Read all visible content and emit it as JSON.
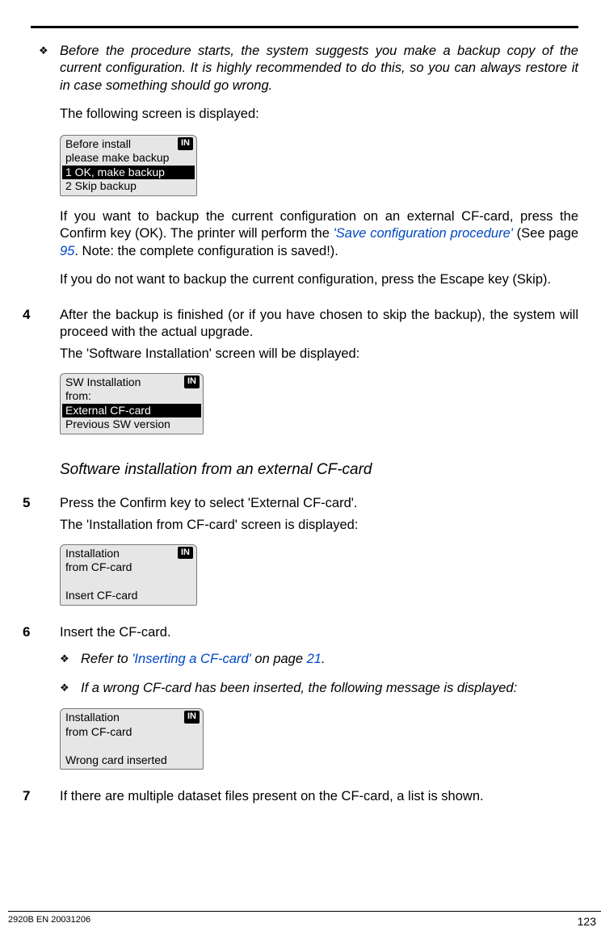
{
  "note1": "Before the procedure starts, the system suggests you make a backup copy of the current configuration. It is highly recommended to do this, so you can always restore it in case something should go wrong.",
  "p_following": "The following screen is displayed:",
  "lcd1": {
    "badge": "IN",
    "l1": "Before install",
    "l2": "please make backup",
    "l3": "1   OK, make backup",
    "l4": "2   Skip backup"
  },
  "p_backup1_a": "If you want to backup the current configuration on an external CF-card, press the Confirm key (OK). The printer will perform the ",
  "link_save": "'Save configuration procedure'",
  "p_backup1_b": " (See page ",
  "page95": "95",
  "p_backup1_c": ". Note: the complete configuration is saved!).",
  "p_backup2": "If you do not want to backup the current configuration, press the Escape key (Skip).",
  "step4_num": "4",
  "step4_p1": "After the backup is finished (or if you have chosen to skip the backup), the system will proceed with the actual upgrade.",
  "step4_p2": "The 'Software Installation' screen will be displayed:",
  "lcd2": {
    "badge": "IN",
    "l1": "SW Installation",
    "l2": "from:",
    "l3": "External CF-card",
    "l4": "Previous SW version"
  },
  "heading": "Software installation from an external CF-card",
  "step5_num": "5",
  "step5_p1": "Press the Confirm key to select 'External CF-card'.",
  "step5_p2": "The 'Installation from CF-card' screen is displayed:",
  "lcd3": {
    "badge": "IN",
    "l1": "Installation",
    "l2": "from CF-card",
    "l4": "Insert CF-card"
  },
  "step6_num": "6",
  "step6_p1": "Insert the CF-card.",
  "note6a_a": "Refer to ",
  "link_insert": "'Inserting a CF-card'",
  "note6a_b": " on page ",
  "page21": "21",
  "note6a_c": ".",
  "note6b": "If a wrong CF-card has been inserted, the following message is displayed:",
  "lcd4": {
    "badge": "IN",
    "l1": "Installation",
    "l2": "from CF-card",
    "l4": "Wrong card inserted"
  },
  "step7_num": "7",
  "step7_p1": "If there are multiple dataset files present on the CF-card, a list is shown.",
  "footer_left": "2920B EN 20031206",
  "footer_right": "123"
}
